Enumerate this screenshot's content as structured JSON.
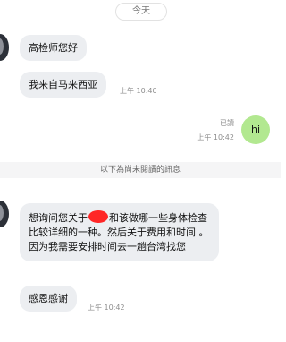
{
  "date_label": "今天",
  "messages": [
    {
      "text": "高检师您好"
    },
    {
      "text": "我来自马来西亚",
      "time": "上午 10:40"
    }
  ],
  "outgoing": {
    "text": "hi",
    "read_label": "已讀",
    "time": "上午 10:42"
  },
  "unread_divider": "以下為尚未閱讀的訊息",
  "message3": {
    "before_redaction": "想询问您关于",
    "after_redaction": "和该做哪一些身体检查 比较详细的一种。然后关于费用和时间 。因为我需要安排时间去一趟台湾找您"
  },
  "message4": {
    "text": "感恩感谢",
    "time": "上午 10:42"
  }
}
